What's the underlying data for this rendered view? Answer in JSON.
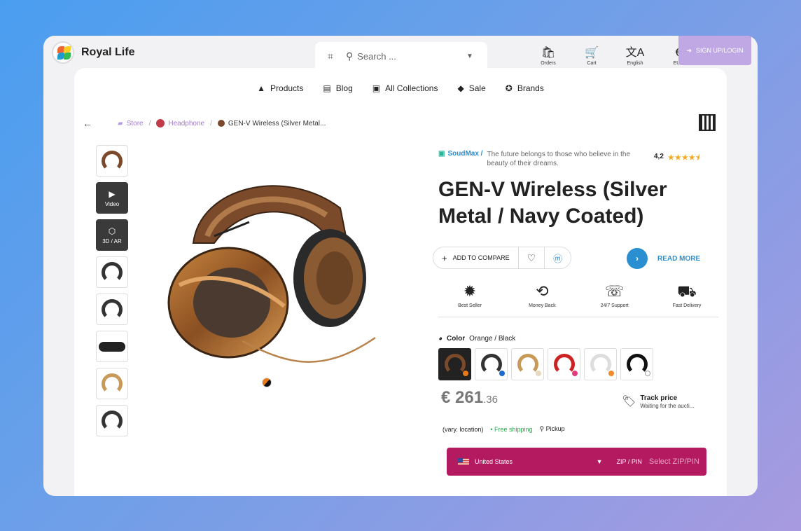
{
  "brand": {
    "name": "Royal Life"
  },
  "search": {
    "placeholder": "Search ..."
  },
  "topbar": {
    "orders": "Orders",
    "cart": "Cart",
    "language": "English",
    "currency": "EUR",
    "signup": "SIGN UP/LOGIN"
  },
  "nav": {
    "products": "Products",
    "blog": "Blog",
    "collections": "All Collections",
    "sale": "Sale",
    "brands": "Brands"
  },
  "breadcrumb": {
    "store": "Store",
    "category": "Headphone",
    "current": "GEN-V Wireless (Silver Metal..."
  },
  "thumbs": {
    "video": "Video",
    "ar": "3D / AR"
  },
  "product": {
    "seller": "SoudMax /",
    "tagline": "The future belongs to those who believe in the beauty of their dreams.",
    "rating": "4,2",
    "stars": "★★★★⯨",
    "title": "GEN-V Wireless (Silver Metal / Navy Coated)",
    "compare": "ADD TO COMPARE",
    "read_more": "READ MORE",
    "badges": [
      "Best Seller",
      "Money Back",
      "24/7 Support",
      "Fast Delivery"
    ],
    "color_label": "Color",
    "color_value": "Orange / Black",
    "price_main": "€ 261",
    "price_cents": ".36",
    "track_title": "Track price",
    "track_sub": "Waiting for the aucti...",
    "vary": "(vary. location)",
    "free_shipping": "• Free shipping",
    "pickup": "Pickup",
    "country": "United States",
    "zip_label": "ZIP / PIN",
    "zip_placeholder": "Select ZIP/PIN"
  },
  "colors": {
    "accent_purple": "#a07cd0",
    "link_blue": "#2a8fd0",
    "zip_bar": "#b31a5f",
    "free_green": "#2aa84a"
  }
}
